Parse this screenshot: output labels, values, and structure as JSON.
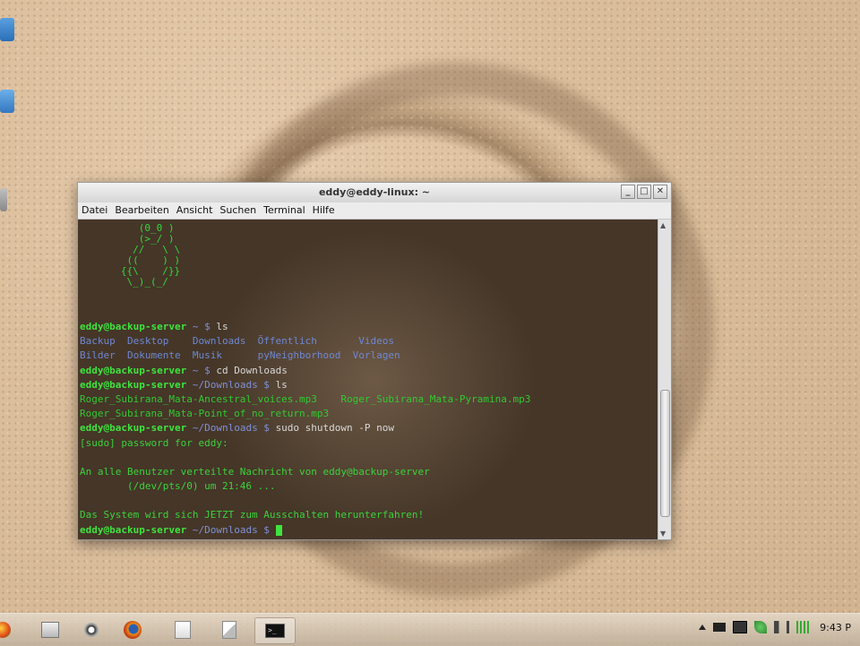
{
  "window": {
    "title": "eddy@eddy-linux: ~",
    "buttons": {
      "minimize": "_",
      "maximize": "□",
      "close": "✕"
    }
  },
  "menu": [
    "Datei",
    "Bearbeiten",
    "Ansicht",
    "Suchen",
    "Terminal",
    "Hilfe"
  ],
  "terminal": {
    "ascii_art": "      (0_0 )\n      (>_/ )\n     //   \\ \\\n    ((    ) )\n   {{\\    /}}\n    \\_)_(_/",
    "lines": [
      {
        "prompt": "eddy@backup-server",
        "path": " ~ $ ",
        "cmd": "ls"
      },
      {
        "dirs": "Backup  Desktop    Downloads  Öffentlich       Videos"
      },
      {
        "dirs": "Bilder  Dokumente  Musik      pyNeighborhood  Vorlagen"
      },
      {
        "prompt": "eddy@backup-server",
        "path": " ~ $ ",
        "cmd": "cd Downloads"
      },
      {
        "prompt": "eddy@backup-server",
        "path": " ~/Downloads $ ",
        "cmd": "ls"
      },
      {
        "files": "Roger_Subirana_Mata-Ancestral_voices.mp3    Roger_Subirana_Mata-Pyramina.mp3"
      },
      {
        "files": "Roger_Subirana_Mata-Point_of_no_return.mp3"
      },
      {
        "prompt": "eddy@backup-server",
        "path": " ~/Downloads $ ",
        "cmd": "sudo shutdown -P now"
      },
      {
        "msg": "[sudo] password for eddy:"
      },
      {
        "msg": ""
      },
      {
        "msg": "An alle Benutzer verteilte Nachricht von eddy@backup-server"
      },
      {
        "msg": "        (/dev/pts/0) um 21:46 ..."
      },
      {
        "msg": ""
      },
      {
        "msg": "Das System wird sich JETZT zum Ausschalten herunterfahren!"
      },
      {
        "prompt": "eddy@backup-server",
        "path": " ~/Downloads $ ",
        "cmd": "",
        "cursor": true
      }
    ]
  },
  "taskbar": {
    "items": [
      "start-orb-icon",
      "file-manager-icon",
      "webcam-icon",
      "firefox-icon",
      "document-icon",
      "text-editor-icon",
      "terminal-icon"
    ],
    "terminal_glyph": ">_",
    "clock": "9:43 P"
  },
  "colors": {
    "prompt": "#3ee43e",
    "path": "#8090d8",
    "dir": "#6e88d4",
    "file": "#32c832"
  }
}
